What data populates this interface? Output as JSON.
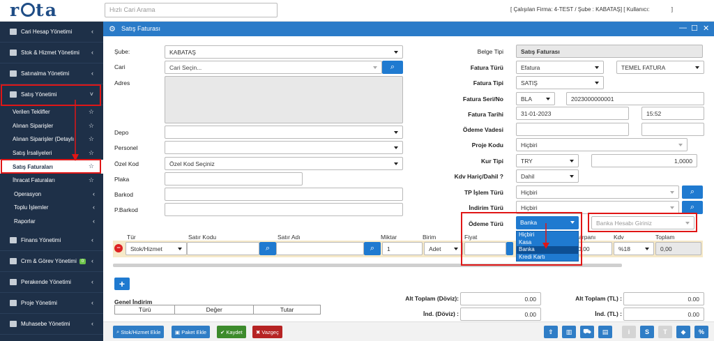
{
  "header": {
    "logo": "rota",
    "search_placeholder": "Hızlı Cari Arama",
    "info": "[ Çalışılan Firma: 4-TEST / Şube : KABATAŞ] [ Kullanıcı:              ]"
  },
  "sidebar": {
    "items_top": [
      {
        "label": "Cari Hesap Yönetimi"
      },
      {
        "label": "Stok & Hizmet Yönetimi"
      },
      {
        "label": "Satınalma Yönetimi"
      },
      {
        "label": "Satış Yönetimi"
      }
    ],
    "sub_items": [
      {
        "label": "Verilen Teklifler"
      },
      {
        "label": "Alınan Siparişler"
      },
      {
        "label": "Alınan Siparişler (Detaylı"
      },
      {
        "label": "Satış İrsaliyeleri"
      },
      {
        "label": "Satış Faturaları"
      },
      {
        "label": "İhracat Faturaları"
      },
      {
        "label": "Operasyon"
      },
      {
        "label": "Toplu İşlemler"
      },
      {
        "label": "Raporlar"
      }
    ],
    "items_bottom": [
      {
        "label": "Finans Yönetimi"
      },
      {
        "label": "Crm & Görev Yönetimi",
        "badge": "0"
      },
      {
        "label": "Perakende Yönetimi"
      },
      {
        "label": "Proje Yönetimi"
      },
      {
        "label": "Muhasebe Yönetimi"
      }
    ]
  },
  "window": {
    "title": "Satış Faturası"
  },
  "form_left": {
    "sube_label": "Şube:",
    "sube_value": "KABATAŞ",
    "cari_label": "Cari",
    "cari_placeholder": "Cari Seçin...",
    "adres_label": "Adres",
    "depo_label": "Depo",
    "personel_label": "Personel",
    "ozelkod_label": "Özel Kod",
    "ozelkod_placeholder": "Özel Kod Seçiniz",
    "plaka_label": "Plaka",
    "barkod_label": "Barkod",
    "pbarkod_label": "P.Barkod"
  },
  "form_right": {
    "belge_tipi_label": "Belge Tipi",
    "belge_tipi_value": "Satış Faturası",
    "fatura_turu_label": "Fatura Türü",
    "fatura_turu_value": "Efatura",
    "fatura_turu_value2": "TEMEL FATURA",
    "fatura_tipi_label": "Fatura Tipi",
    "fatura_tipi_value": "SATIŞ",
    "seri_no_label": "Fatura Seri/No",
    "seri_value": "BLA",
    "no_value": "2023000000001",
    "tarih_label": "Fatura Tarihi",
    "tarih_value": "31-01-2023",
    "saat_value": "15:52",
    "odeme_vadesi_label": "Ödeme Vadesi",
    "proje_kodu_label": "Proje Kodu",
    "proje_kodu_value": "Hiçbiri",
    "kur_tipi_label": "Kur Tipi",
    "kur_tipi_value": "TRY",
    "kur_value": "1,0000",
    "kdv_label": "Kdv Hariç/Dahil ?",
    "kdv_value": "Dahil",
    "tp_label": "TP İşlem Türü",
    "tp_value": "Hiçbiri",
    "indirim_label": "İndirim Türü",
    "indirim_value": "Hiçbiri",
    "odeme_turu_label": "Ödeme Türü",
    "odeme_turu_value": "Banka",
    "banka_placeholder": "Banka Hesabı Giriniz",
    "odeme_options": [
      "Hiçbiri",
      "Kasa",
      "Banka",
      "Kredi Kartı"
    ],
    "odeme_selected_index": 2
  },
  "lines": {
    "headers": {
      "tur": "Tür",
      "satir_kodu": "Satır Kodu",
      "satir_adi": "Satır Adı",
      "miktar": "Miktar",
      "birim": "Birim",
      "fiyat": "Fiyat",
      "carpani": "Çarpanı",
      "kdv": "Kdv",
      "toplam": "Toplam"
    },
    "row": {
      "tur": "Stok/Hizmet",
      "miktar": "1",
      "birim": "Adet",
      "carpani": "0,00",
      "kdv": "%18",
      "toplam": "0,00"
    }
  },
  "totals": {
    "genel_indirim": "Genel İndirim",
    "cols": [
      "Türü",
      "Değer",
      "Tutar"
    ],
    "alt_toplam_doviz": "Alt Toplam (Döviz):",
    "alt_toplam_doviz_value": "0.00",
    "ind_doviz": "İnd. (Döviz) :",
    "ind_doviz_value": "0.00",
    "alt_toplam_tl": "Alt Toplam (TL) :",
    "alt_toplam_tl_value": "0.00",
    "ind_tl": "İnd. (TL) :",
    "ind_tl_value": "0.00"
  },
  "buttons": {
    "stok_ekle": "Stok/Hizmet Ekle",
    "paket_ekle": "Paket Ekle",
    "kaydet": "Kaydet",
    "vazgec": "Vazgeç",
    "s1": "S",
    "s2": "T"
  },
  "colors": {
    "primary": "#2a7bc8",
    "sidebar": "#1e3048",
    "highlight": "#e01616"
  }
}
